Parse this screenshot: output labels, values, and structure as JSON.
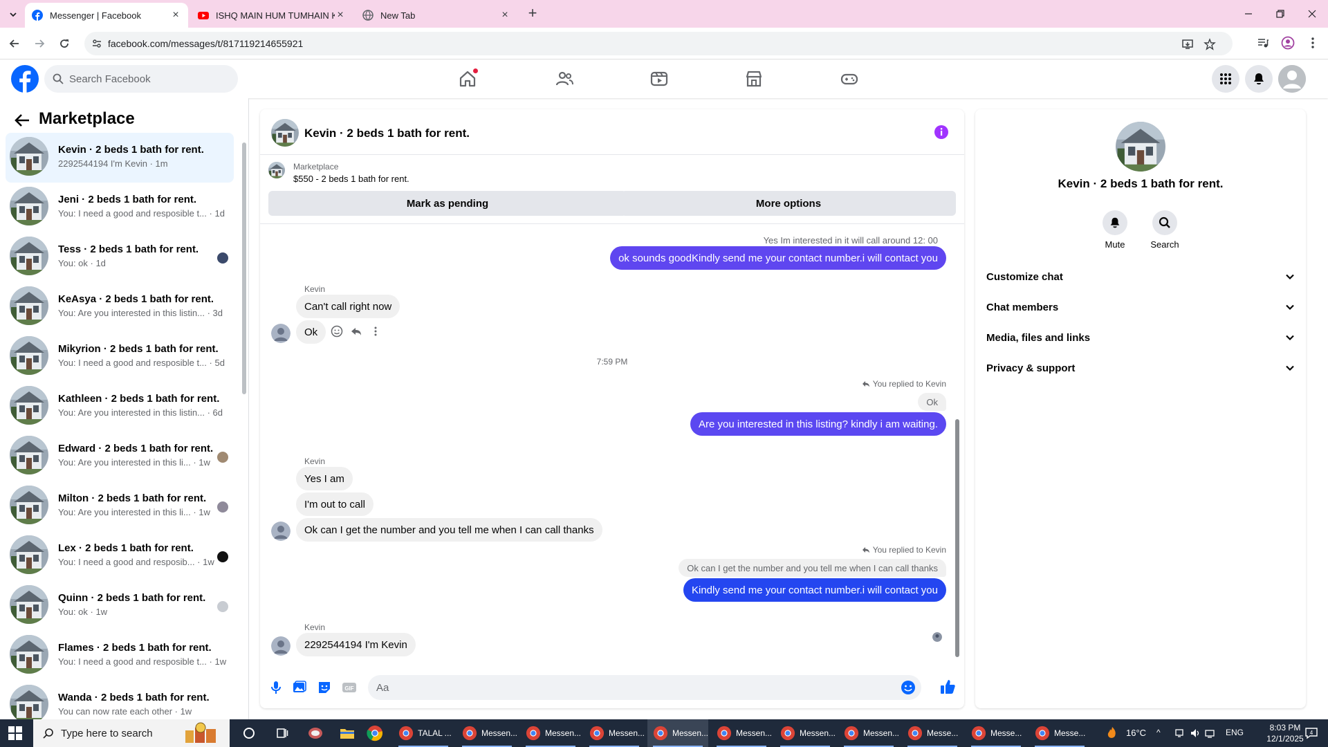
{
  "browser": {
    "tabs": [
      {
        "title": "Messenger | Facebook",
        "active": true
      },
      {
        "title": "ISHQ MAIN HUM TUMHAIN KI",
        "active": false
      },
      {
        "title": "New Tab",
        "active": false
      }
    ],
    "url": "facebook.com/messages/t/817119214655921"
  },
  "facebook": {
    "search_placeholder": "Search Facebook",
    "accent": "#0866ff"
  },
  "sidebar": {
    "title": "Marketplace",
    "conversations": [
      {
        "name": "Kevin · 2 beds 1 bath for rent.",
        "preview": "2292544194 I'm Kevin · 1m",
        "active": true
      },
      {
        "name": "Jeni · 2 beds 1 bath for rent.",
        "preview": "You: I need a good and resposible t... · 1d"
      },
      {
        "name": "Tess · 2 beds 1 bath for rent.",
        "preview": "You: ok · 1d"
      },
      {
        "name": "KeAsya · 2 beds 1 bath for rent.",
        "preview": "You: Are you interested in this listin... · 3d"
      },
      {
        "name": "Mikyrion · 2 beds 1 bath for rent.",
        "preview": "You: I need a good and resposible t... · 5d"
      },
      {
        "name": "Kathleen · 2 beds 1 bath for rent.",
        "preview": "You: Are you interested in this listin... · 6d"
      },
      {
        "name": "Edward · 2 beds 1 bath for rent.",
        "preview": "You: Are you interested in this li... · 1w"
      },
      {
        "name": "Milton · 2 beds 1 bath for rent.",
        "preview": "You: Are you interested in this li... · 1w"
      },
      {
        "name": "Lex · 2 beds 1 bath for rent.",
        "preview": "You: I need a good and resposib... · 1w"
      },
      {
        "name": "Quinn · 2 beds 1 bath for rent.",
        "preview": "You: ok · 1w"
      },
      {
        "name": "Flames · 2 beds 1 bath for rent.",
        "preview": "You: I need a good and resposible t... · 1w"
      },
      {
        "name": "Wanda · 2 beds 1 bath for rent.",
        "preview": "You can now rate each other · 1w"
      }
    ]
  },
  "chat": {
    "title": "Kevin · 2 beds 1 bath for rent.",
    "marketplace_label": "Marketplace",
    "listing": "$550 - 2 beds 1 bath for rent.",
    "mark_pending": "Mark as pending",
    "more_options": "More options",
    "messages": {
      "quote1": "Yes Im interested in it will call around 12: 00",
      "out1": "ok sounds goodKindly send me your contact number.i will contact you",
      "sender": "Kevin",
      "in1": "Can't call right now",
      "in2": "Ok",
      "timestamp": "7:59 PM",
      "reply_note": "You replied to Kevin",
      "quote2": "Ok",
      "out2": "Are you interested in this listing? kindly i am waiting.",
      "in3": "Yes I am",
      "in4": "I'm out to call",
      "in5": "Ok can I get the number and you tell me when I can call thanks",
      "quote3": "Ok can I get the number and you tell me when I can call thanks",
      "out3": "Kindly send me your contact number.i will contact you",
      "in6": "2292544194 I'm Kevin"
    },
    "composer_placeholder": "Aa",
    "bubble_color": "#5b48f1"
  },
  "info_panel": {
    "name": "Kevin · 2 beds 1 bath for rent.",
    "actions": [
      "Mute",
      "Search"
    ],
    "sections": [
      "Customize chat",
      "Chat members",
      "Media, files and links",
      "Privacy & support"
    ]
  },
  "taskbar": {
    "search_placeholder": "Type here to search",
    "apps": [
      {
        "label": "TALAL ...",
        "active": false
      },
      {
        "label": "Messen...",
        "active": false
      },
      {
        "label": "Messen...",
        "active": false
      },
      {
        "label": "Messen...",
        "active": false
      },
      {
        "label": "Messen...",
        "active": true
      },
      {
        "label": "Messen...",
        "active": false
      },
      {
        "label": "Messen...",
        "active": false
      },
      {
        "label": "Messen...",
        "active": false
      },
      {
        "label": "Messe...",
        "active": false
      },
      {
        "label": "Messe...",
        "active": false
      },
      {
        "label": "Messe...",
        "active": false
      }
    ],
    "weather": "16°C",
    "language": "ENG",
    "time": "8:03 PM",
    "date": "12/1/2025",
    "notification_count": "4"
  }
}
